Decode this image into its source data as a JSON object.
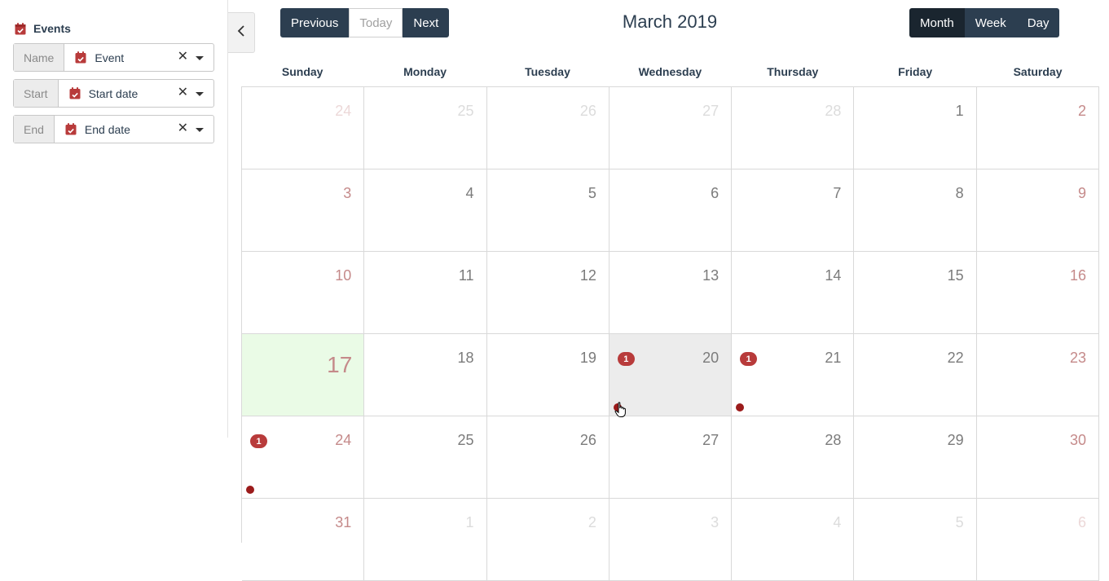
{
  "sidebar": {
    "title": "Events",
    "icon": "calendar-check-icon",
    "fields": [
      {
        "label": "Name",
        "value": "Event"
      },
      {
        "label": "Start",
        "value": "Start date"
      },
      {
        "label": "End",
        "value": "End date"
      }
    ],
    "clear_glyph": "✕"
  },
  "toolbar": {
    "previous_label": "Previous",
    "today_label": "Today",
    "next_label": "Next",
    "title": "March 2019",
    "views": [
      "Month",
      "Week",
      "Day"
    ],
    "active_view": "Month"
  },
  "calendar": {
    "day_headers": [
      "Sunday",
      "Monday",
      "Tuesday",
      "Wednesday",
      "Thursday",
      "Friday",
      "Saturday"
    ],
    "weeks": [
      [
        "24",
        "25",
        "26",
        "27",
        "28",
        "1",
        "2"
      ],
      [
        "3",
        "4",
        "5",
        "6",
        "7",
        "8",
        "9"
      ],
      [
        "10",
        "11",
        "12",
        "13",
        "14",
        "15",
        "16"
      ],
      [
        "17",
        "18",
        "19",
        "20",
        "21",
        "22",
        "23"
      ],
      [
        "24",
        "25",
        "26",
        "27",
        "28",
        "29",
        "30"
      ],
      [
        "31",
        "1",
        "2",
        "3",
        "4",
        "5",
        "6"
      ]
    ],
    "badge_count": "1"
  },
  "colors": {
    "primary": "#2c3e50",
    "accent_red": "#b83b3b",
    "today_bg": "#eafbe6",
    "selected_bg": "#ececec"
  }
}
